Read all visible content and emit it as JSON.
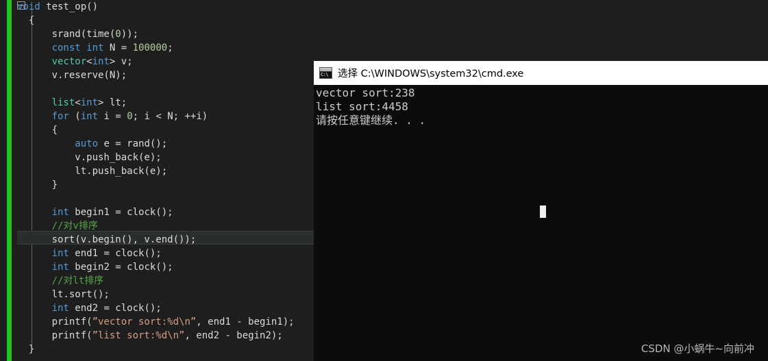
{
  "editor": {
    "name": "visual-studio-code-editor",
    "background": "#1e1e1e",
    "change_bar_color": "#21c521",
    "current_line_number": 18,
    "colors": {
      "keyword": "#569cd6",
      "type": "#4ec9b0",
      "number": "#b5cea8",
      "string": "#d69d85",
      "comment": "#57a64a",
      "plain": "#dcdcdc",
      "current_line_highlight": "#2a2d2e"
    },
    "lines": [
      [
        {
          "t": "void",
          "c": "kw"
        },
        {
          "t": " test_op()",
          "c": "pln"
        }
      ],
      [
        {
          "t": "  {",
          "c": "pln"
        }
      ],
      [
        {
          "t": "      srand(time(",
          "c": "pln"
        },
        {
          "t": "0",
          "c": "num"
        },
        {
          "t": "));",
          "c": "pln"
        }
      ],
      [
        {
          "t": "      ",
          "c": "pln"
        },
        {
          "t": "const",
          "c": "kw"
        },
        {
          "t": " ",
          "c": "pln"
        },
        {
          "t": "int",
          "c": "kw"
        },
        {
          "t": " N = ",
          "c": "pln"
        },
        {
          "t": "100000",
          "c": "num"
        },
        {
          "t": ";",
          "c": "pln"
        }
      ],
      [
        {
          "t": "      ",
          "c": "pln"
        },
        {
          "t": "vector",
          "c": "typ"
        },
        {
          "t": "<",
          "c": "pln"
        },
        {
          "t": "int",
          "c": "kw"
        },
        {
          "t": "> v;",
          "c": "pln"
        }
      ],
      [
        {
          "t": "      v.reserve(N);",
          "c": "pln"
        }
      ],
      [
        {
          "t": "",
          "c": "pln"
        }
      ],
      [
        {
          "t": "      ",
          "c": "pln"
        },
        {
          "t": "list",
          "c": "typ"
        },
        {
          "t": "<",
          "c": "pln"
        },
        {
          "t": "int",
          "c": "kw"
        },
        {
          "t": "> lt;",
          "c": "pln"
        }
      ],
      [
        {
          "t": "      ",
          "c": "pln"
        },
        {
          "t": "for",
          "c": "kw"
        },
        {
          "t": " (",
          "c": "pln"
        },
        {
          "t": "int",
          "c": "kw"
        },
        {
          "t": " i = ",
          "c": "pln"
        },
        {
          "t": "0",
          "c": "num"
        },
        {
          "t": "; i < N; ++i)",
          "c": "pln"
        }
      ],
      [
        {
          "t": "      {",
          "c": "pln"
        }
      ],
      [
        {
          "t": "          ",
          "c": "pln"
        },
        {
          "t": "auto",
          "c": "kw"
        },
        {
          "t": " e = rand();",
          "c": "pln"
        }
      ],
      [
        {
          "t": "          v.push_back(e);",
          "c": "pln"
        }
      ],
      [
        {
          "t": "          lt.push_back(e);",
          "c": "pln"
        }
      ],
      [
        {
          "t": "      }",
          "c": "pln"
        }
      ],
      [
        {
          "t": "",
          "c": "pln"
        }
      ],
      [
        {
          "t": "      ",
          "c": "pln"
        },
        {
          "t": "int",
          "c": "kw"
        },
        {
          "t": " begin1 = clock();",
          "c": "pln"
        }
      ],
      [
        {
          "t": "      ",
          "c": "pln"
        },
        {
          "t": "//对v排序",
          "c": "cmt"
        }
      ],
      [
        {
          "t": "      sort(v.begin(), v.end());",
          "c": "pln"
        }
      ],
      [
        {
          "t": "      ",
          "c": "pln"
        },
        {
          "t": "int",
          "c": "kw"
        },
        {
          "t": " end1 = clock();",
          "c": "pln"
        }
      ],
      [
        {
          "t": "      ",
          "c": "pln"
        },
        {
          "t": "int",
          "c": "kw"
        },
        {
          "t": " begin2 = clock();",
          "c": "pln"
        }
      ],
      [
        {
          "t": "      ",
          "c": "pln"
        },
        {
          "t": "//对lt排序",
          "c": "cmt"
        }
      ],
      [
        {
          "t": "      lt.sort();",
          "c": "pln"
        }
      ],
      [
        {
          "t": "      ",
          "c": "pln"
        },
        {
          "t": "int",
          "c": "kw"
        },
        {
          "t": " end2 = clock();",
          "c": "pln"
        }
      ],
      [
        {
          "t": "      printf(",
          "c": "pln"
        },
        {
          "t": "”vector sort:%d\\n”",
          "c": "str"
        },
        {
          "t": ", end1 - begin1);",
          "c": "pln"
        }
      ],
      [
        {
          "t": "      printf(",
          "c": "pln"
        },
        {
          "t": "”list sort:%d\\n”",
          "c": "str"
        },
        {
          "t": ", end2 - begin2);",
          "c": "pln"
        }
      ],
      [
        {
          "t": "  }",
          "c": "pln"
        }
      ]
    ]
  },
  "console": {
    "titlebar": {
      "icon_name": "cmd-exe-icon",
      "icon_text": "C:\\",
      "title": "选择 C:\\WINDOWS\\system32\\cmd.exe"
    },
    "background": "#0c0c0c",
    "text_color": "#cccccc",
    "output_lines": [
      "vector sort:238",
      "list sort:4458",
      "请按任意键继续. . ."
    ],
    "cursor_visible": true
  },
  "watermark": {
    "text": "CSDN @小蜗牛~向前冲"
  }
}
